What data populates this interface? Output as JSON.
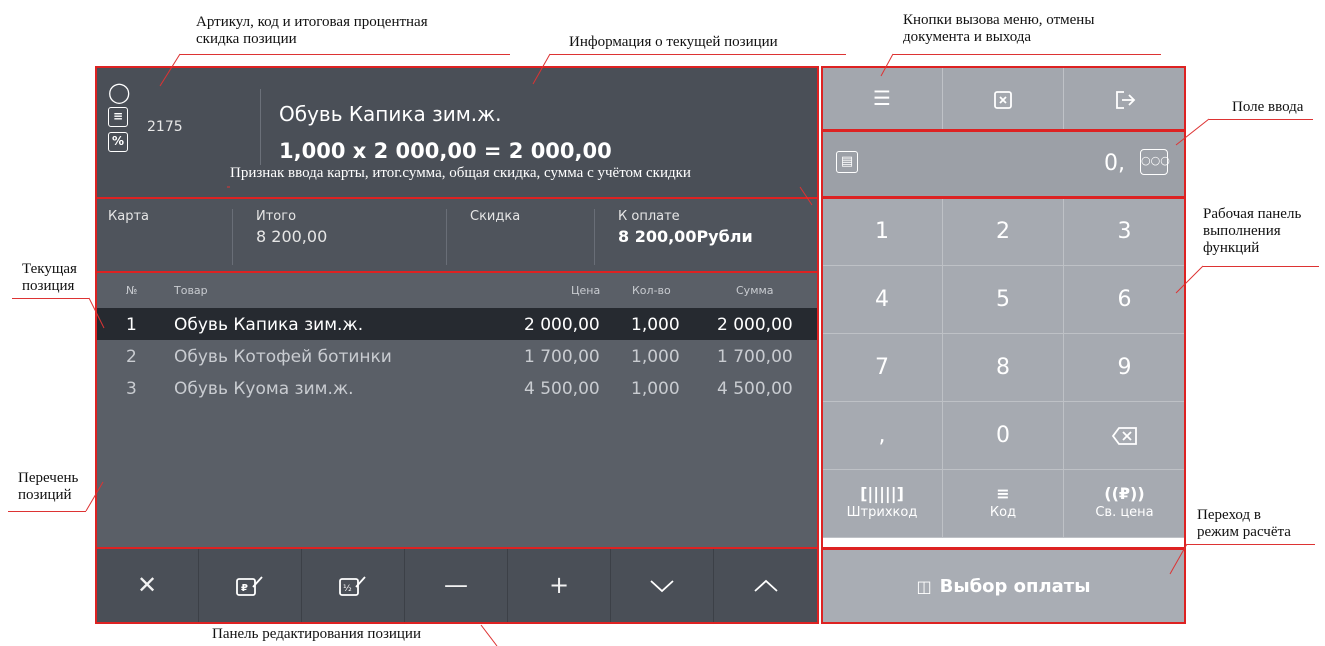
{
  "annotations": {
    "article": [
      "Артикул, код и итоговая процентная",
      "скидка позиции"
    ],
    "info": "Информация о текущей позиции",
    "menu_buttons": [
      "Кнопки вызова меню, отмены",
      "документа и выхода"
    ],
    "input_field": "Поле ввода",
    "totals_hint": "Признак ввода карты, итог.сумма, общая скидка, сумма с учётом скидки",
    "work_panel": [
      "Рабочая панель",
      "выполнения",
      "функций"
    ],
    "current_position": [
      "Текущая",
      "позиция"
    ],
    "position_list": [
      "Перечень",
      "позиций"
    ],
    "payment_mode": [
      "Переход в",
      "режим расчёта"
    ],
    "edit_panel": "Панель редактирования позиции"
  },
  "current_item": {
    "code": "2175",
    "name": "Обувь Капика зим.ж.",
    "formula": "1,000 x 2 000,00 = 2 000,00"
  },
  "totals": {
    "card_label": "Карта",
    "total_label": "Итого",
    "total_value": "8 200,00",
    "discount_label": "Скидка",
    "pay_label": "К оплате",
    "pay_value": "8 200,00Рубли"
  },
  "list": {
    "headers": {
      "num": "№",
      "product": "Товар",
      "price": "Цена",
      "qty": "Кол-во",
      "sum": "Сумма"
    },
    "rows": [
      {
        "num": "1",
        "name": "Обувь Капика зим.ж.",
        "price": "2 000,00",
        "qty": "1,000",
        "sum": "2 000,00"
      },
      {
        "num": "2",
        "name": "Обувь Котофей ботинки",
        "price": "1 700,00",
        "qty": "1,000",
        "sum": "1 700,00"
      },
      {
        "num": "3",
        "name": "Обувь Куома зим.ж.",
        "price": "4 500,00",
        "qty": "1,000",
        "sum": "4 500,00"
      }
    ]
  },
  "input": {
    "value": "0,"
  },
  "keypad": {
    "keys": [
      "1",
      "2",
      "3",
      "4",
      "5",
      "6",
      "7",
      "8",
      "9",
      ",",
      "0"
    ],
    "barcode_label": "Штрихкод",
    "code_label": "Код",
    "free_price_label": "Св. цена"
  },
  "payment_button": "Выбор оплаты",
  "colors": {
    "panel_dark": "#4a4f57",
    "panel_light": "#a9adb4",
    "highlight": "#d22"
  }
}
